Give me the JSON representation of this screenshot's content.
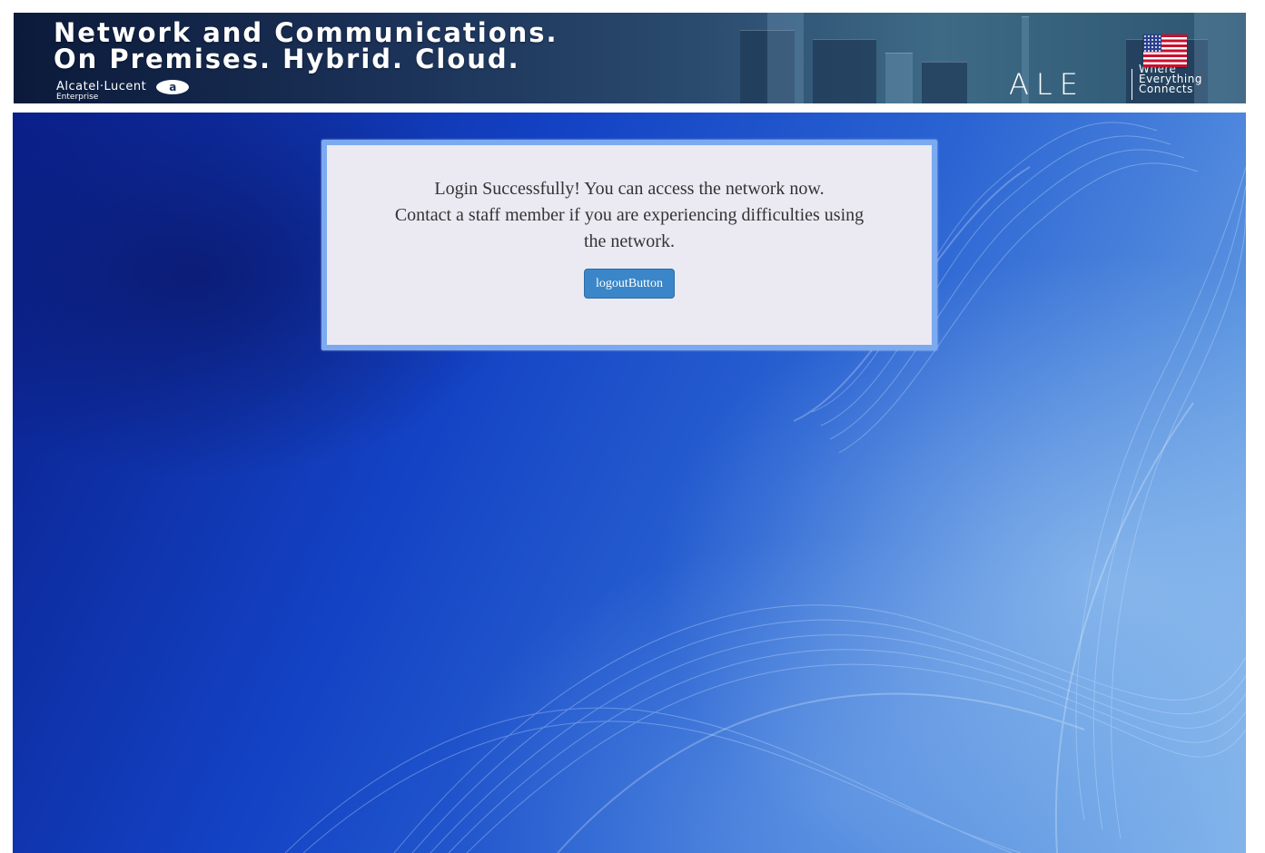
{
  "banner": {
    "headline_line1": "Network and Communications.",
    "headline_line2": "On Premises. Hybrid. Cloud.",
    "brand_name": "Alcatel·Lucent",
    "brand_sub": "Enterprise",
    "ale_logo": "ALE",
    "tagline": [
      "Where",
      "Everything",
      "Connects"
    ],
    "language_flag_icon": "us-flag-icon"
  },
  "login_result": {
    "message_line1": "Login Successfully! You can access the network now.",
    "message_line2": "Contact a staff member if you are experiencing difficulties using",
    "message_line3": "the network.",
    "logout_label": "logoutButton"
  },
  "colors": {
    "card_border": "#7baaf0",
    "card_background": "#ebeaf3",
    "button": "#3a86c8",
    "page_background": "#1342c4"
  }
}
